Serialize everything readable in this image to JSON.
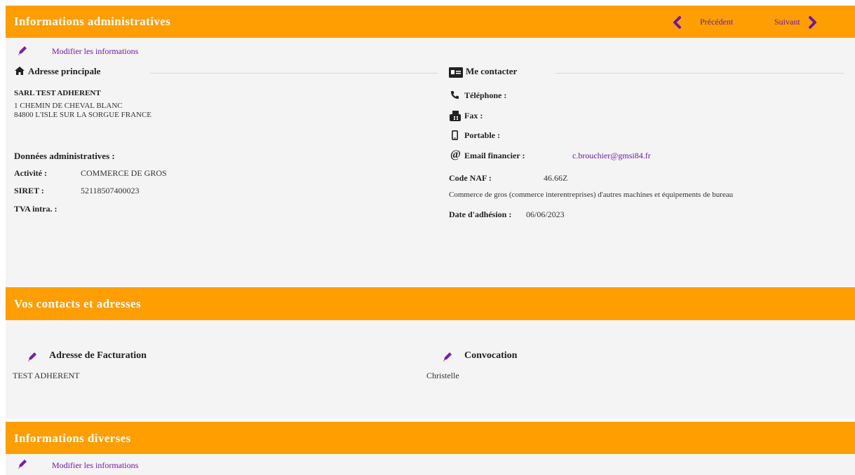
{
  "section1": {
    "title": "Informations administratives",
    "nav": {
      "previous": "Précédent",
      "next": "Suivant"
    },
    "edit_link": "Modifier les informations",
    "address": {
      "heading": "Adresse principale",
      "company": "SARL TEST ADHERENT",
      "line1": "1 CHEMIN DE CHEVAL BLANC",
      "line2": "84800 L'ISLE SUR LA SORGUE FRANCE"
    },
    "admin": {
      "heading": "Données administratives :",
      "activity_label": "Activité :",
      "activity_value": "COMMERCE DE GROS",
      "siret_label": "SIRET :",
      "siret_value": "52118507400023",
      "tva_label": "TVA intra. :"
    },
    "contact": {
      "heading": "Me contacter",
      "phone_label": "Téléphone :",
      "fax_label": "Fax :",
      "mobile_label": "Portable :",
      "email_label": "Email financier :",
      "email_value": "c.brouchier@gmsi84.fr",
      "naf_label": "Code NAF :",
      "naf_value": "46.66Z",
      "naf_desc": "Commerce de gros (commerce interentreprises) d'autres machines et équipements de bureau",
      "join_label": "Date d'adhésion :",
      "join_value": "06/06/2023"
    }
  },
  "section2": {
    "title": "Vos contacts et adresses",
    "billing": {
      "heading": "Adresse de Facturation",
      "value": "TEST ADHERENT"
    },
    "convocation": {
      "heading": "Convocation",
      "value": "Christelle"
    }
  },
  "section3": {
    "title": "Informations diverses",
    "edit_link": "Modifier les informations"
  },
  "colors": {
    "band": "#fe9e00",
    "accent": "#6e1a9e",
    "panel": "#f4f4f4"
  },
  "icons": [
    "pencil-icon",
    "home-icon",
    "contact-card-icon",
    "phone-icon",
    "fax-icon",
    "mobile-icon",
    "at-icon",
    "chevron-left-icon",
    "chevron-right-icon"
  ]
}
